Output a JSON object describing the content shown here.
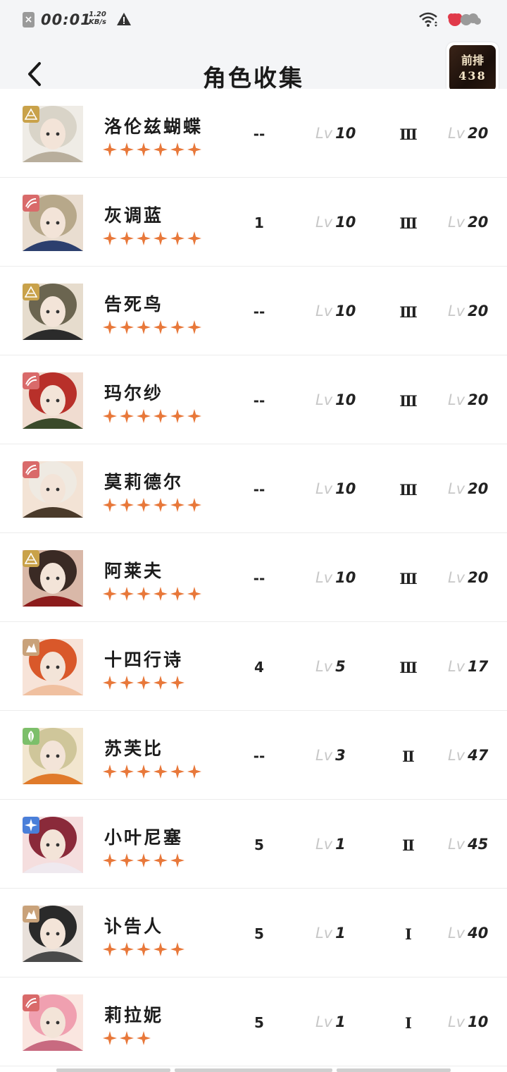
{
  "status_bar": {
    "time": "00:01",
    "speed_value": "1.20",
    "speed_unit": "KB/s"
  },
  "header": {
    "title": "角色收集",
    "rank_label": "前排",
    "rank_value": "438"
  },
  "colors": {
    "star": "#e8783a",
    "badge_red": "#d96a6a",
    "badge_gold": "#c9a24a",
    "badge_tan": "#c9a27a",
    "badge_green": "#7cbf6a",
    "badge_blue": "#4a7fd9"
  },
  "characters": [
    {
      "name": "洛伦兹蝴蝶",
      "stars": 6,
      "badge_icon": "pyramid-icon",
      "col_a": "--",
      "lv_prefix": "Lv",
      "lv1": "10",
      "tier": "Ⅲ",
      "lv2": "20"
    },
    {
      "name": "灰调蓝",
      "stars": 6,
      "badge_icon": "claw-icon",
      "col_a": "1",
      "lv_prefix": "Lv",
      "lv1": "10",
      "tier": "Ⅲ",
      "lv2": "20"
    },
    {
      "name": "告死鸟",
      "stars": 6,
      "badge_icon": "pyramid-icon",
      "col_a": "--",
      "lv_prefix": "Lv",
      "lv1": "10",
      "tier": "Ⅲ",
      "lv2": "20"
    },
    {
      "name": "玛尔纱",
      "stars": 6,
      "badge_icon": "claw-icon",
      "col_a": "--",
      "lv_prefix": "Lv",
      "lv1": "10",
      "tier": "Ⅲ",
      "lv2": "20"
    },
    {
      "name": "莫莉德尔",
      "stars": 6,
      "badge_icon": "claw-icon",
      "col_a": "--",
      "lv_prefix": "Lv",
      "lv1": "10",
      "tier": "Ⅲ",
      "lv2": "20"
    },
    {
      "name": "阿莱夫",
      "stars": 6,
      "badge_icon": "pyramid-icon",
      "col_a": "--",
      "lv_prefix": "Lv",
      "lv1": "10",
      "tier": "Ⅲ",
      "lv2": "20"
    },
    {
      "name": "十四行诗",
      "stars": 5,
      "badge_icon": "rock-icon",
      "col_a": "4",
      "lv_prefix": "Lv",
      "lv1": "5",
      "tier": "Ⅲ",
      "lv2": "17"
    },
    {
      "name": "苏芙比",
      "stars": 6,
      "badge_icon": "leaf-icon",
      "col_a": "--",
      "lv_prefix": "Lv",
      "lv1": "3",
      "tier": "Ⅱ",
      "lv2": "47"
    },
    {
      "name": "小叶尼塞",
      "stars": 5,
      "badge_icon": "star-burst-icon",
      "col_a": "5",
      "lv_prefix": "Lv",
      "lv1": "1",
      "tier": "Ⅱ",
      "lv2": "45"
    },
    {
      "name": "讣告人",
      "stars": 5,
      "badge_icon": "rock-icon",
      "col_a": "5",
      "lv_prefix": "Lv",
      "lv1": "1",
      "tier": "Ⅰ",
      "lv2": "40"
    },
    {
      "name": "莉拉妮",
      "stars": 3,
      "badge_icon": "claw-icon",
      "col_a": "5",
      "lv_prefix": "Lv",
      "lv1": "1",
      "tier": "Ⅰ",
      "lv2": "10"
    }
  ]
}
